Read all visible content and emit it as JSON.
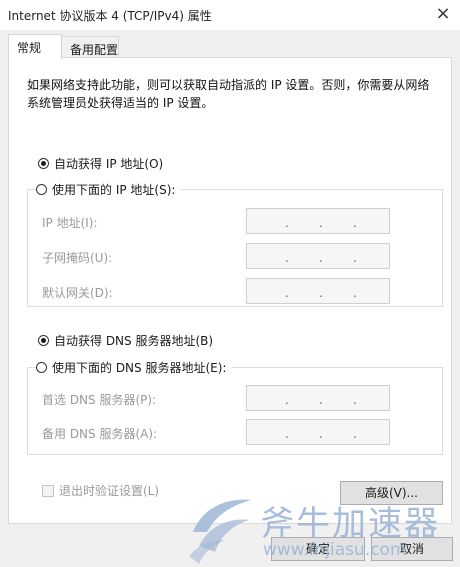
{
  "window": {
    "title": "Internet 协议版本 4 (TCP/IPv4) 属性",
    "close_glyph": "×"
  },
  "tabs": [
    {
      "label": "常规",
      "active": true
    },
    {
      "label": "备用配置",
      "active": false
    }
  ],
  "general": {
    "description": "如果网络支持此功能，则可以获取自动指派的 IP 设置。否则，你需要从网络系统管理员处获得适当的 IP 设置。",
    "ip": {
      "auto_label": "自动获得 IP 地址(O)",
      "auto_selected": true,
      "manual_label": "使用下面的 IP 地址(S):",
      "fields": [
        {
          "label": "IP 地址(I):",
          "value": ".  .  ."
        },
        {
          "label": "子网掩码(U):",
          "value": ".  .  ."
        },
        {
          "label": "默认网关(D):",
          "value": ".  .  ."
        }
      ]
    },
    "dns": {
      "auto_label": "自动获得 DNS 服务器地址(B)",
      "auto_selected": true,
      "manual_label": "使用下面的 DNS 服务器地址(E):",
      "fields": [
        {
          "label": "首选 DNS 服务器(P):",
          "value": ".  .  ."
        },
        {
          "label": "备用 DNS 服务器(A):",
          "value": ".  .  ."
        }
      ]
    },
    "validate_label": "退出时验证设置(L)",
    "validate_checked": false,
    "advanced_button": "高级(V)..."
  },
  "footer": {
    "ok_button": "确定",
    "cancel_button": "取消"
  },
  "watermark": {
    "text": "斧牛加速器",
    "url": "www.fnjiasu.com"
  },
  "colors": {
    "disabled_text": "#9a9a9a",
    "watermark": "#9eb6d6"
  }
}
